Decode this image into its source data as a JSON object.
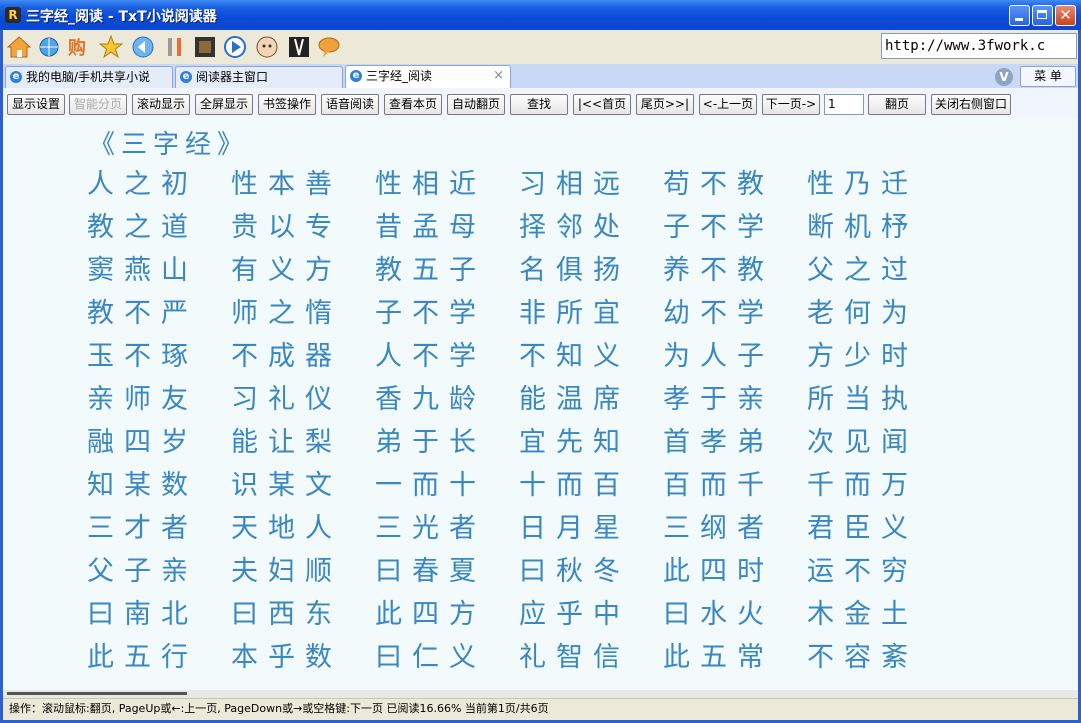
{
  "window": {
    "title": "三字经_阅读 - TxT小说阅读器",
    "app_icon_letter": "R",
    "close_glyph": "✕"
  },
  "toolbar": {
    "icons": [
      "home-icon",
      "network-icon",
      "shop-icon",
      "star-icon",
      "back-icon",
      "tools-icon",
      "film-icon",
      "play-icon",
      "avatar-icon",
      "figure-icon",
      "chat-icon"
    ],
    "address": "http://www.3fwork.c"
  },
  "tabs": [
    {
      "label": "我的电脑/手机共享小说",
      "active": false
    },
    {
      "label": "阅读器主窗口",
      "active": false
    },
    {
      "label": "三字经_阅读",
      "active": true
    }
  ],
  "tabbar": {
    "v_label": "V",
    "menu_label": "菜 单",
    "tab_close": "×"
  },
  "commands": {
    "display_settings": "显示设置",
    "smart_paging": "智能分页",
    "scroll_display": "滚动显示",
    "fullscreen": "全屏显示",
    "bookmark": "书签操作",
    "voice_read": "语音阅读",
    "view_page": "查看本页",
    "auto_turn": "自动翻页",
    "find": "查找",
    "first_page": "|<<首页",
    "last_page": "尾页>>|",
    "prev_page": "<-上一页",
    "next_page": "下一页->",
    "page_value": "1",
    "turn_page": "翻页",
    "close_right": "关闭右侧窗口"
  },
  "content": {
    "title": "《三字经》",
    "lines": [
      [
        "人之初",
        "性本善",
        "性相近",
        "习相远",
        "苟不教",
        "性乃迁"
      ],
      [
        "教之道",
        "贵以专",
        "昔孟母",
        "择邻处",
        "子不学",
        "断机杼"
      ],
      [
        "窦燕山",
        "有义方",
        "教五子",
        "名俱扬",
        "养不教",
        "父之过"
      ],
      [
        "教不严",
        "师之惰",
        "子不学",
        "非所宜",
        "幼不学",
        "老何为"
      ],
      [
        "玉不琢",
        "不成器",
        "人不学",
        "不知义",
        "为人子",
        "方少时"
      ],
      [
        "亲师友",
        "习礼仪",
        "香九龄",
        "能温席",
        "孝于亲",
        "所当执"
      ],
      [
        "融四岁",
        "能让梨",
        "弟于长",
        "宜先知",
        "首孝弟",
        "次见闻"
      ],
      [
        "知某数",
        "识某文",
        "一而十",
        "十而百",
        "百而千",
        "千而万"
      ],
      [
        "三才者",
        "天地人",
        "三光者",
        "日月星",
        "三纲者",
        "君臣义"
      ],
      [
        "父子亲",
        "夫妇顺",
        "曰春夏",
        "曰秋冬",
        "此四时",
        "运不穷"
      ],
      [
        "曰南北",
        "曰西东",
        "此四方",
        "应乎中",
        "曰水火",
        "木金土"
      ],
      [
        "此五行",
        "本乎数",
        "曰仁义",
        "礼智信",
        "此五常",
        "不容紊"
      ]
    ]
  },
  "status": {
    "text": "操作：滚动鼠标:翻页, PageUp或←:上一页, PageDown或→或空格键:下一页 已阅读16.66% 当前第1页/共6页"
  }
}
